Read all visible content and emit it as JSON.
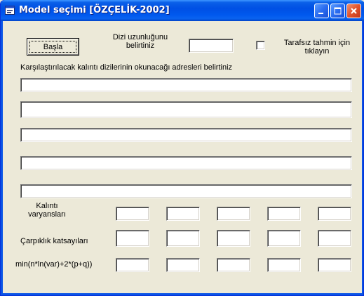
{
  "window": {
    "title": "Model seçimi [ÖZÇELİK-2002]",
    "icon": "form-icon",
    "controls": [
      "minimize-icon",
      "maximize-icon",
      "close-icon"
    ]
  },
  "form": {
    "start_button": "Başla",
    "length_label_line1": "Dizi uzunluğunu",
    "length_label_line2": "belirtiniz",
    "length_value": "",
    "unbiased_label_line1": "Tarafsız tahmin için",
    "unbiased_label_line2": "tıklayın",
    "unbiased_checked": false,
    "addresses_label": "Karşılaştırılacak kalıntı dizilerinin okunacağı adresleri belirtiniz",
    "addresses": [
      "",
      "",
      "",
      "",
      ""
    ],
    "row_labels": {
      "variances_line1": "Kalıntı",
      "variances_line2": "varyansları",
      "skewness": "Çarpıklık katsayıları",
      "criterion": "min(n*ln(var)+2*(p+q))"
    },
    "variances": [
      "",
      "",
      "",
      "",
      ""
    ],
    "skewness": [
      "",
      "",
      "",
      "",
      ""
    ],
    "criterion": [
      "",
      "",
      "",
      "",
      ""
    ]
  },
  "colors": {
    "titlebar": "#0054e3",
    "window_face": "#ece9d8",
    "close_button": "#e0532c"
  }
}
